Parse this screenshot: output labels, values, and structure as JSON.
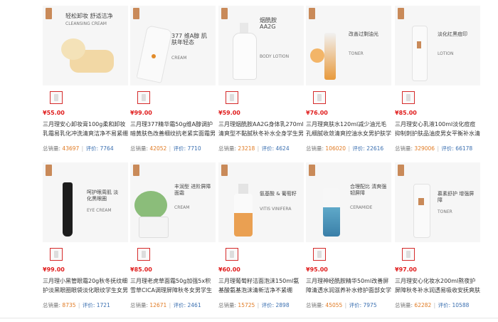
{
  "labels": {
    "sales": "总销量:",
    "reviews": "评价:"
  },
  "colors": {
    "price": "#e01d1d",
    "sales": "#e07a22",
    "reviews": "#3a6fb0"
  },
  "products": [
    {
      "caption": "轻松卸妆 舒适洁净",
      "sub": "CLEANSING CREAM",
      "price": "¥55.00",
      "title": "三月理安心卸妆膏100g柔和卸妆乳霜易乳化冲洗清爽洁净不易紧绷",
      "sales": "43697",
      "reviews": "7764"
    },
    {
      "caption": "377 维A醇 肌肤年轻态",
      "sub": "CREAM",
      "price": "¥99.00",
      "title": "三月理377精华霜50g维A醇调护暗黄肤色改善细纹抗老紧实面霜男女",
      "sales": "42052",
      "reviews": "7710"
    },
    {
      "caption": "烟酰胺 AA2G",
      "sub": "BODY LOTION",
      "price": "¥59.00",
      "title": "三月理烟酰胺AA2G身体乳270ml清爽型不黏腻秋冬补水全身学生男",
      "sales": "23218",
      "reviews": "4624"
    },
    {
      "caption": "改善过剩油光",
      "sub": "TONER",
      "price": "¥76.00",
      "title": "三月理爽肤水120ml减少油光毛孔细腻收敛清爽控油水女男护肤学生",
      "sales": "106020",
      "reviews": "22616"
    },
    {
      "caption": "淡化红黑痘印",
      "sub": "LOTION",
      "price": "¥85.00",
      "title": "三月理安心乳液100ml淡化痘痘抑制刺护肤品油皮男女平衡补水清爽",
      "sales": "329006",
      "reviews": "66178"
    },
    {
      "caption": "呵护眼周肌 淡化黑眼圈",
      "sub": "EYE CREAM",
      "price": "¥99.00",
      "title": "三月理小黑管眼霜20g秋冬抚纹细护淡黑眼圈眼袋淡化眼纹学生女男",
      "sales": "8735",
      "reviews": "1721"
    },
    {
      "caption": "丰润型 进阶屏障面霜",
      "sub": "CREAM",
      "price": "¥85.00",
      "title": "三月理老虎草面霜50g加强5x积雪草CICA调理屏障秋冬女男学生乳",
      "sales": "12671",
      "reviews": "2461"
    },
    {
      "caption": "氨基酸 & 葡萄籽",
      "sub": "VITIS VINIFERA",
      "price": "¥60.00",
      "title": "三月理葡萄籽洁面泡沫150ml氨基酸氨基泡沫清新洁净不紧绷",
      "sales": "15725",
      "reviews": "2898"
    },
    {
      "caption": "合理配比 清爽强韧屏障",
      "sub": "CERAMIDE",
      "price": "¥95.00",
      "title": "三月理神经酰胺精华50ml改善屏障清透水润滋养补水修护面部女学",
      "sales": "45055",
      "reviews": "7975"
    },
    {
      "caption": "慕素舒护 增强屏障",
      "sub": "TONER",
      "price": "¥97.00",
      "title": "三月理安心化妆水200ml熬夜护屏障秋冬补水润透易吸收安抚爽肤",
      "sales": "62282",
      "reviews": "10588"
    }
  ]
}
